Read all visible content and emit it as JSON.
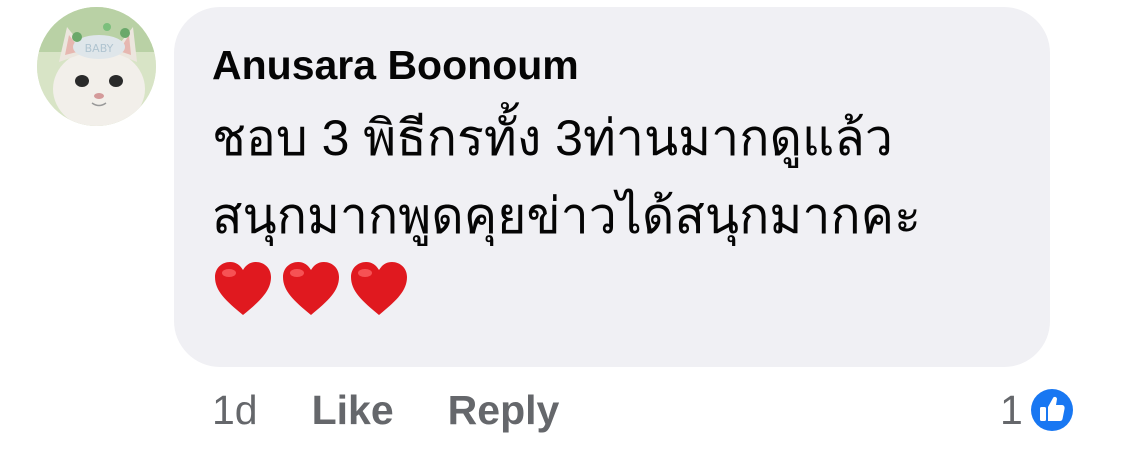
{
  "comment": {
    "author": "Anusara Boonoum",
    "body_line1": "ชอบ 3 พิธีกรทั้ง 3ท่านมากดูแล้ว",
    "body_line2": "สนุกมากพูดคุยข่าวได้สนุกมากคะ",
    "emojis": [
      "heart-icon",
      "heart-icon",
      "heart-icon"
    ],
    "timestamp": "1d",
    "like_label": "Like",
    "reply_label": "Reply",
    "reaction_count": "1",
    "reaction_icon": "like-icon"
  },
  "colors": {
    "bubble": "#f0f0f4",
    "text": "#050505",
    "meta": "#65676b",
    "like_blue": "#1877f2",
    "heart_red": "#e0191f"
  }
}
